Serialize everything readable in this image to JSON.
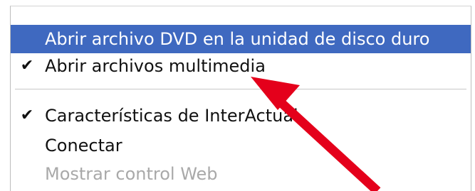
{
  "menu": {
    "items": [
      {
        "label": "Abrir archivo DVD en la unidad de disco duro",
        "checked": false,
        "selected": true,
        "disabled": false
      },
      {
        "label": "Abrir archivos multimedia",
        "checked": true,
        "selected": false,
        "disabled": false
      },
      {
        "label": "Características de InterActual",
        "checked": true,
        "selected": false,
        "disabled": false
      },
      {
        "label": "Conectar",
        "checked": false,
        "selected": false,
        "disabled": false
      },
      {
        "label": "Mostrar control Web",
        "checked": false,
        "selected": false,
        "disabled": true
      }
    ]
  },
  "icons": {
    "check": "checkmark-icon",
    "annotation_arrow": "red-arrow-annotation"
  },
  "colors": {
    "highlight": "#3f69c0",
    "disabled_text": "#a9a9a9",
    "arrow": "#e4001b"
  }
}
